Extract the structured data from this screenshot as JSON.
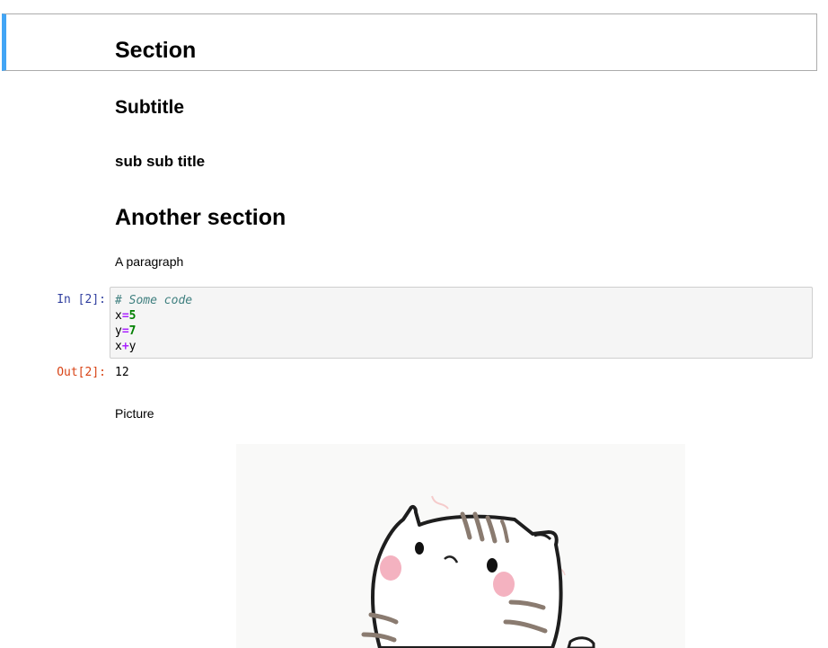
{
  "cells": {
    "section_title": "Section",
    "subtitle": "Subtitle",
    "subsubtitle": "sub sub title",
    "another_section": "Another section",
    "paragraph": "A paragraph",
    "code_cell": {
      "in_prompt": "In [2]:",
      "lines": {
        "comment": "# Some code",
        "l2_name": "x",
        "l2_op": "=",
        "l2_num": "5",
        "l3_name": "y",
        "l3_op": "=",
        "l3_num": "7",
        "l4_a": "x",
        "l4_op": "+",
        "l4_b": "y"
      },
      "out_prompt": "Out[2]:",
      "output": "12"
    },
    "picture_label": "Picture",
    "picture": {
      "subject": "sketch of a cat"
    }
  },
  "colors": {
    "selected_cell_border": "#42a5f5",
    "in_prompt": "#303f9f",
    "out_prompt": "#d84315",
    "code_background": "#f5f5f5"
  }
}
